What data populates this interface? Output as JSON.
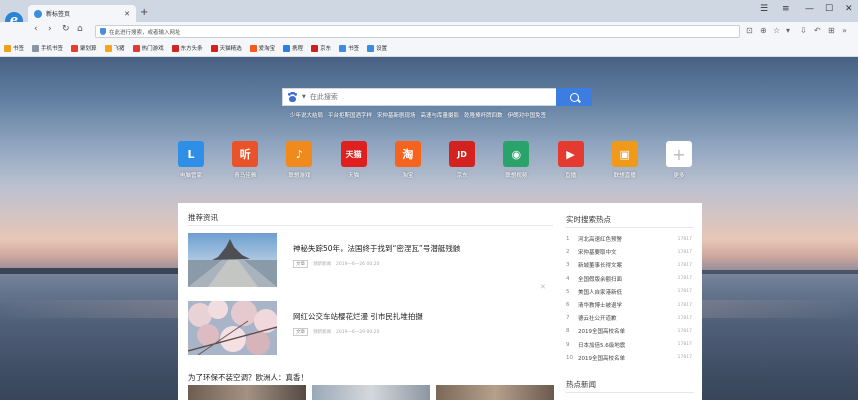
{
  "browser": {
    "tab_title": "新标签页",
    "tab_close": "✕",
    "new_tab": "+",
    "address_placeholder": "在此进行搜索，或者输入网址"
  },
  "bookmarks": [
    {
      "label": "书签",
      "icon": "star-icon",
      "color": "#f0a020"
    },
    {
      "label": "手机书签",
      "icon": "phone-icon",
      "color": "#8a94a5"
    },
    {
      "label": "聚划算",
      "icon": "juhuasuan-icon",
      "color": "#e63c2e"
    },
    {
      "label": "飞猪",
      "icon": "feizhu-icon",
      "color": "#f5a524"
    },
    {
      "label": "热门游戏",
      "icon": "game-icon",
      "color": "#e03a3a"
    },
    {
      "label": "东方头条",
      "icon": "toutiao-icon",
      "color": "#d4261e"
    },
    {
      "label": "天猫精选",
      "icon": "tmall-icon",
      "color": "#d81e1e"
    },
    {
      "label": "爱淘宝",
      "icon": "taobao-icon",
      "color": "#f55a1f"
    },
    {
      "label": "携程",
      "icon": "ctrip-icon",
      "color": "#2f7fe0"
    },
    {
      "label": "京东",
      "icon": "jd-icon",
      "color": "#d11f1f"
    },
    {
      "label": "书签",
      "icon": "star-icon",
      "color": "#3b8de0"
    },
    {
      "label": "设置",
      "icon": "settings-icon",
      "color": "#3b8de0"
    }
  ],
  "search": {
    "placeholder": "在此搜索",
    "hot_links": [
      "少年说大结局",
      "平台拒斯国酒字样",
      "宋仲基新剧现场",
      "高速与库量摄影",
      "乾隆捧杯牌四数",
      "伊朗对中国免签"
    ]
  },
  "tiles": [
    {
      "label": "电脑管家",
      "glyph": "L",
      "color": "#2f8fe6"
    },
    {
      "label": "青马佳雅",
      "glyph": "听",
      "color": "#e8532c"
    },
    {
      "label": "联想游戏",
      "glyph": "♪",
      "color": "#f08a1c"
    },
    {
      "label": "天猫",
      "glyph": "天猫",
      "color": "#e01f1f"
    },
    {
      "label": "淘宝",
      "glyph": "淘",
      "color": "#f5641e"
    },
    {
      "label": "京东",
      "glyph": "JD",
      "color": "#d3221f"
    },
    {
      "label": "联想视频",
      "glyph": "◉",
      "color": "#2aa36b"
    },
    {
      "label": "直播",
      "glyph": "▶",
      "color": "#e53a2f"
    },
    {
      "label": "联想直播",
      "glyph": "▣",
      "color": "#f09a1c"
    },
    {
      "label": "更多",
      "glyph": "+",
      "color": "#ffffff"
    }
  ],
  "news": {
    "section_title": "推荐资讯",
    "items": [
      {
        "headline": "神秘失踪50年，法国终于找到“密涅瓦”号潜艇残骸",
        "tag": "文章",
        "source": "领新新闻",
        "date": "2019—6—26 00:20"
      },
      {
        "headline": "网红公交车站樱花烂漫 引市民扎堆拍摄",
        "tag": "文章",
        "source": "领新新闻",
        "date": "2019—6—29 00:20"
      }
    ],
    "close": "✕",
    "sub_headline": "为了环保不装空调？欧洲人：真香！"
  },
  "hot_search": {
    "title": "实时搜索热点",
    "items": [
      {
        "rank": "1",
        "text": "河北高速红色预警",
        "count": "17817"
      },
      {
        "rank": "2",
        "text": "宋仲基要取中文",
        "count": "17817"
      },
      {
        "rank": "3",
        "text": "新城董事长得文案",
        "count": "17817"
      },
      {
        "rank": "4",
        "text": "全国假版余额扫面",
        "count": "17817"
      },
      {
        "rank": "5",
        "text": "美国人自家港新低",
        "count": "17817"
      },
      {
        "rank": "6",
        "text": "清华教博士被退学",
        "count": "17817"
      },
      {
        "rank": "7",
        "text": "德云社公开道歉",
        "count": "17817"
      },
      {
        "rank": "8",
        "text": "2019全国高校名单",
        "count": "17817"
      },
      {
        "rank": "9",
        "text": "日本加倍5.6级地震",
        "count": "17817"
      },
      {
        "rank": "10",
        "text": "2019全国高校名单",
        "count": "17817"
      }
    ],
    "title2": "热点新闻"
  }
}
